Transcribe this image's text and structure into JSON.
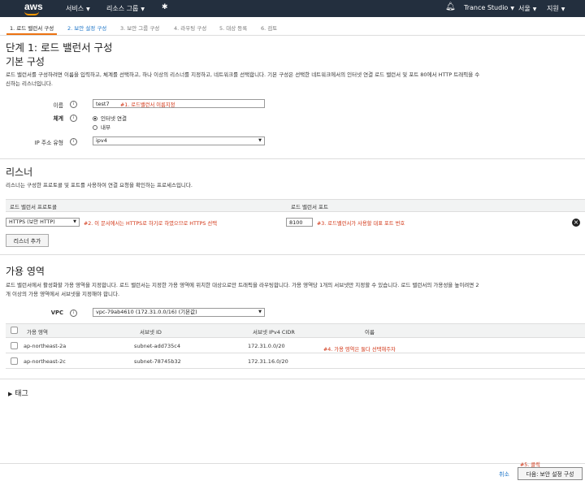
{
  "nav": {
    "logo": "aws",
    "services": "서비스",
    "resource_groups": "리소스 그룹",
    "account": "Trance Studio",
    "region": "서울",
    "support": "지원"
  },
  "steps": [
    "1. 로드 밸런서 구성",
    "2. 보안 설정 구성",
    "3. 보안 그룹 구성",
    "4. 라우팅 구성",
    "5. 대상 등록",
    "6. 검토"
  ],
  "page_title": "단계 1: 로드 밸런서 구성",
  "basic": {
    "heading": "기본 구성",
    "description_line1": "로드 밸런서를 구성하려면 이름을 입력하고, 체계를 선택하고, 하나 이상의 리스너를 지정하고, 네트워크를 선택합니다. 기본 구성은 선택한 네트워크에서의 인터넷 연결 로드 밸런서 및 포트 80에서 HTTP 트래픽을 수",
    "description_line2": "신하는 리스너입니다.",
    "name_label": "이름",
    "name_value": "test7",
    "name_note": "#1. 로드밸런서 이름지정",
    "scheme_label": "체계",
    "scheme_option1": "인터넷 연결",
    "scheme_option2": "내부",
    "ip_label": "IP 주소 유형",
    "ip_value": "ipv4"
  },
  "listeners": {
    "heading": "리스너",
    "description": "리스너는 구성한 프로토콜 및 포트를 사용하여 연결 요청을 확인하는 프로세스입니다.",
    "col_protocol": "로드 밸런서 프로토콜",
    "col_port": "로드 밸런서 포트",
    "protocol_value": "HTTPS (보안 HTTP)",
    "protocol_note": "#2. 이 문서에서는 HTTPS로 하기로 하였으므로 HTTPS 선택",
    "port_value": "8100",
    "port_note": "#3. 로드밸런서가 사용할 대표 포트 번호",
    "add_button": "리스너 추가"
  },
  "az": {
    "heading": "가용 영역",
    "description_line1": "로드 밸런서에서 활성화할 가용 영역을 지정합니다. 로드 밸런서는 지정한 가용 영역에 위치한 대상으로만 트래픽을 라우팅합니다. 가용 영역당 1개의 서브넷만 지정할 수 있습니다. 로드 밸런서의 가용성을 높이려면 2",
    "description_line2": "개 이상의 가용 영역에서 서브넷을 지정해야 합니다.",
    "vpc_label": "VPC",
    "vpc_value": "vpc-79ab4610 (172.31.0.0/16) (기본값)",
    "columns": [
      "가용 영역",
      "서브넷 ID",
      "서브넷 IPv4 CIDR",
      "이름"
    ],
    "rows": [
      {
        "zone": "ap-northeast-2a",
        "subnet": "subnet-add735c4",
        "cidr": "172.31.0.0/20",
        "name": ""
      },
      {
        "zone": "ap-northeast-2c",
        "subnet": "subnet-78745b32",
        "cidr": "172.31.16.0/20",
        "name": ""
      }
    ],
    "note": "#4. 가용 영역은 둘다 선택해주자"
  },
  "tags": {
    "heading": "태그"
  },
  "footer": {
    "click_note": "#5. 클릭",
    "cancel": "취소",
    "next": "다음: 보안 설정 구성"
  },
  "colors": {
    "nav_bg": "#232f3e",
    "accent": "#ec7211",
    "note_red": "#d13212",
    "link": "#1a73c7"
  },
  "icons": [
    "bell-icon",
    "pin-icon",
    "info-icon",
    "close-icon",
    "caret-right-icon"
  ]
}
